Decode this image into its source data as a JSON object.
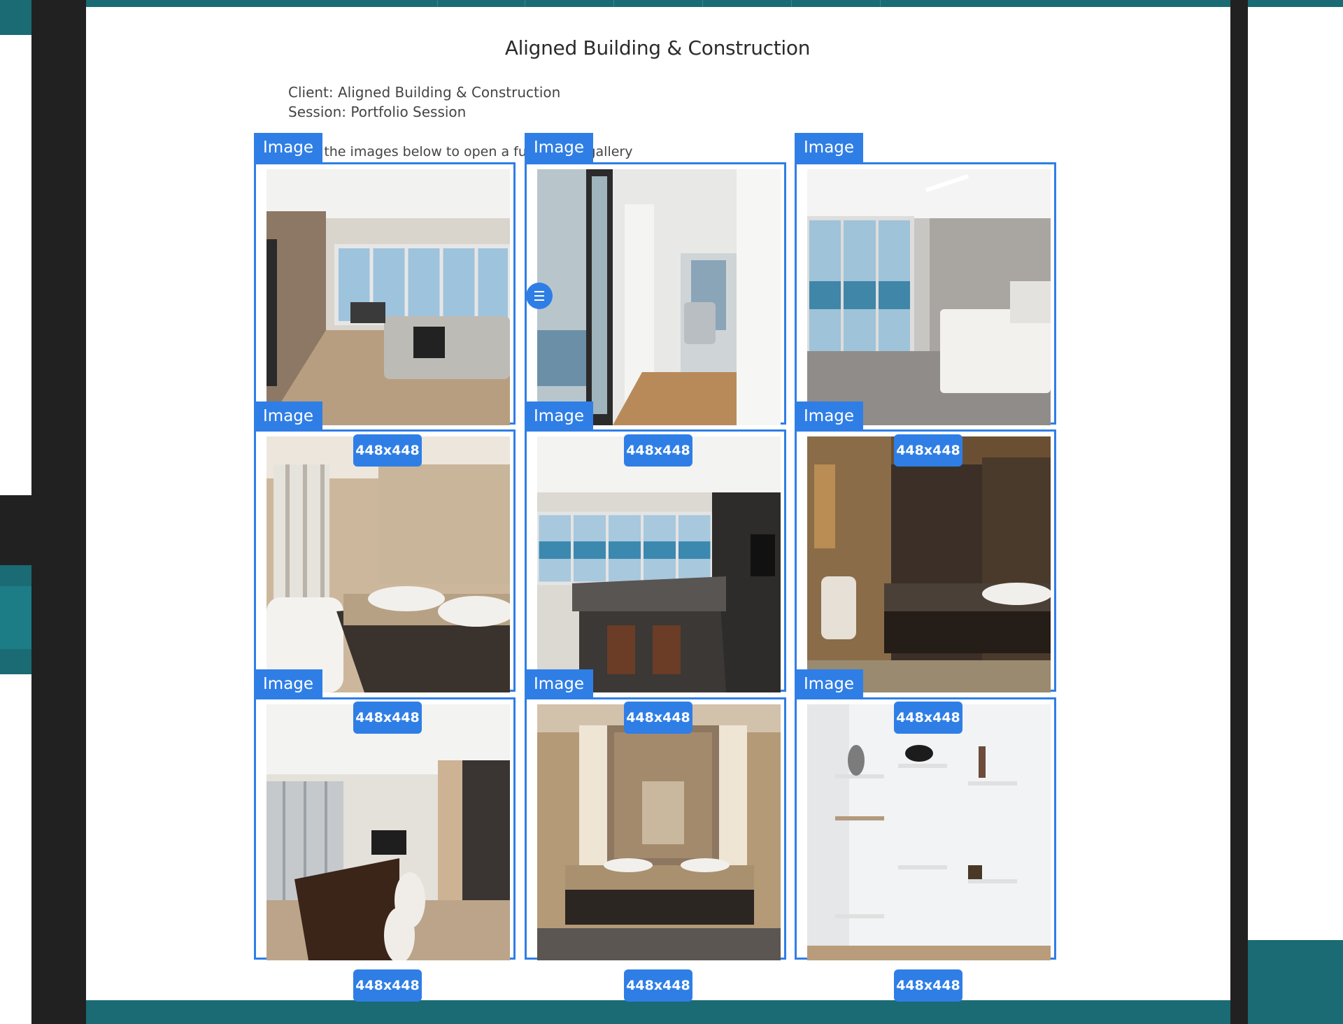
{
  "page": {
    "title": "Aligned Building & Construction",
    "client_line": "Client: Aligned Building & Construction",
    "session_line": "Session: Portfolio Session",
    "instruction": "Click the images below to open a full-screen gallery"
  },
  "gallery": {
    "tag_label": "Image",
    "size_label": "448x448",
    "images": [
      {
        "subject": "living-room"
      },
      {
        "subject": "hallway-with-armchair"
      },
      {
        "subject": "bedroom-ocean-view"
      },
      {
        "subject": "bathroom-double-vanity"
      },
      {
        "subject": "kitchen-island"
      },
      {
        "subject": "dark-bathroom"
      },
      {
        "subject": "dining-room"
      },
      {
        "subject": "bathroom-mirror"
      },
      {
        "subject": "display-shelving"
      }
    ]
  },
  "colors": {
    "accent": "#2f7ee6",
    "teal": "#1a6b73",
    "dark": "#212121"
  },
  "icons": {
    "menu_handle": "hamburger-icon"
  }
}
